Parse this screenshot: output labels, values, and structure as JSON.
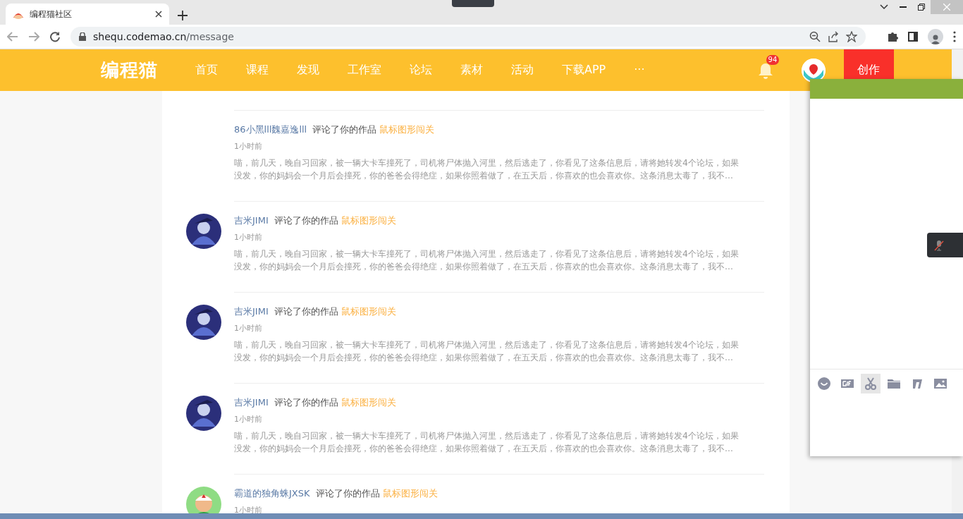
{
  "browser": {
    "tab_title": "编程猫社区",
    "url_host": "shequ.codemao.cn",
    "url_path": "/message"
  },
  "header": {
    "logo": "编程猫",
    "nav": [
      {
        "label": "首页"
      },
      {
        "label": "课程"
      },
      {
        "label": "发现"
      },
      {
        "label": "工作室"
      },
      {
        "label": "论坛"
      },
      {
        "label": "素材"
      },
      {
        "label": "活动"
      },
      {
        "label": "下载APP"
      },
      {
        "label": "···"
      }
    ],
    "notification_count": "94",
    "create_button": "创作"
  },
  "messages": [
    {
      "kind": "plain",
      "user": "86小黑lll魏嘉逸lll",
      "action": "评论了你的作品",
      "work": "鼠标图形闯关",
      "time": "1小时前",
      "body": [
        "喵，前几天，晚自习回家，被一辆大卡车撞死了，司机将尸体抛入河里，然后逃走了，你看见了这条信息后，请将她转发4个论坛，如果",
        "没发，你的妈妈会一个月后会撞死，你的爸爸会得绝症，如果你照着做了，在五天后，你喜欢的也会喜欢你。这条消息太毒了，我不..."
      ]
    },
    {
      "kind": "blue",
      "user": "吉米JIMI",
      "action": "评论了你的作品",
      "work": "鼠标图形闯关",
      "time": "1小时前",
      "body": [
        "喵，前几天，晚自习回家，被一辆大卡车撞死了，司机将尸体抛入河里，然后逃走了，你看见了这条信息后，请将她转发4个论坛，如果",
        "没发，你的妈妈会一个月后会撞死，你的爸爸会得绝症，如果你照着做了，在五天后，你喜欢的也会喜欢你。这条消息太毒了，我不..."
      ]
    },
    {
      "kind": "blue",
      "user": "吉米JIMI",
      "action": "评论了你的作品",
      "work": "鼠标图形闯关",
      "time": "1小时前",
      "body": [
        "喵，前几天，晚自习回家，被一辆大卡车撞死了，司机将尸体抛入河里，然后逃走了，你看见了这条信息后，请将她转发4个论坛，如果",
        "没发，你的妈妈会一个月后会撞死，你的爸爸会得绝症，如果你照着做了，在五天后，你喜欢的也会喜欢你。这条消息太毒了，我不..."
      ]
    },
    {
      "kind": "blue",
      "user": "吉米JIMI",
      "action": "评论了你的作品",
      "work": "鼠标图形闯关",
      "time": "1小时前",
      "body": [
        "喵，前几天，晚自习回家，被一辆大卡车撞死了，司机将尸体抛入河里，然后逃走了，你看见了这条信息后，请将她转发4个论坛，如果",
        "没发，你的妈妈会一个月后会撞死，你的爸爸会得绝症，如果你照着做了，在五天后，你喜欢的也会喜欢你。这条消息太毒了，我不..."
      ]
    },
    {
      "kind": "green",
      "user": "霸道的独角蛛JXSK",
      "action": "评论了你的作品",
      "work": "鼠标图形闯关",
      "time": "1小时前"
    }
  ],
  "chat_panel": {
    "tools": [
      {
        "kind": "emoji",
        "selected": false
      },
      {
        "kind": "gif",
        "selected": false
      },
      {
        "kind": "scissors",
        "selected": true
      },
      {
        "kind": "folder",
        "selected": false
      },
      {
        "kind": "music",
        "selected": false
      },
      {
        "kind": "image",
        "selected": false
      }
    ]
  }
}
